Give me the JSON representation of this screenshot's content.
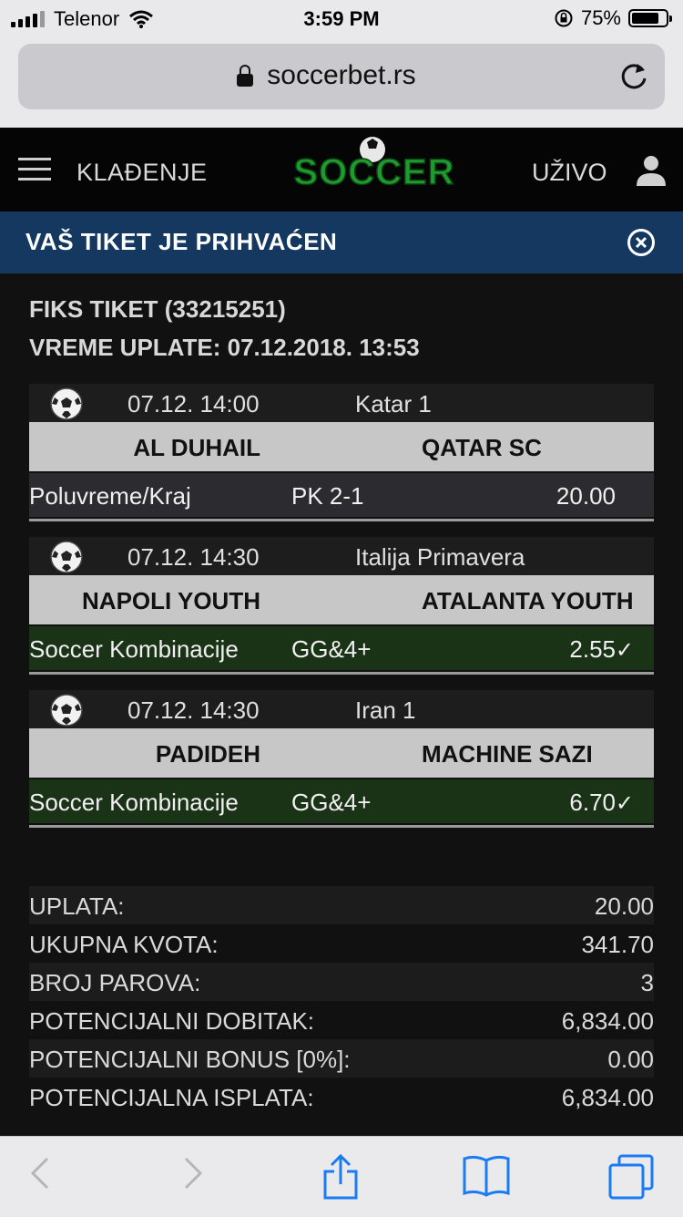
{
  "status_bar": {
    "carrier": "Telenor",
    "time": "3:59 PM",
    "battery": "75%",
    "battery_level": 0.75
  },
  "browser": {
    "host": "soccerbet.rs"
  },
  "header": {
    "menu_label": "KLAĐENJE",
    "logo_text": "SOCCER",
    "live_label": "UŽIVO"
  },
  "banner": {
    "message": "VAŠ TIKET JE PRIHVAĆEN"
  },
  "ticket": {
    "title": "FIKS TIKET (33215251)",
    "payment_time": "VREME UPLATE: 07.12.2018. 13:53"
  },
  "matches": [
    {
      "date": "07.12. 14:00",
      "league": "Katar 1",
      "home": "AL DUHAIL",
      "away": "QATAR SC",
      "market": "Poluvreme/Kraj",
      "pick": "PK 2-1",
      "odd": "20.00",
      "check": ""
    },
    {
      "date": "07.12. 14:30",
      "league": "Italija Primavera",
      "home": "NAPOLI YOUTH",
      "away": "ATALANTA YOUTH",
      "market": "Soccer Kombinacije",
      "pick": "GG&4+",
      "odd": "2.55",
      "check": "✓"
    },
    {
      "date": "07.12. 14:30",
      "league": "Iran 1",
      "home": "PADIDEH",
      "away": "MACHINE SAZI",
      "market": "Soccer Kombinacije",
      "pick": "GG&4+",
      "odd": "6.70",
      "check": "✓"
    }
  ],
  "summary": [
    {
      "label": "UPLATA:",
      "value": "20.00"
    },
    {
      "label": "UKUPNA KVOTA:",
      "value": "341.70"
    },
    {
      "label": "BROJ PAROVA:",
      "value": "3"
    },
    {
      "label": "POTENCIJALNI DOBITAK:",
      "value": "6,834.00"
    },
    {
      "label": "POTENCIJALNI BONUS [0%]:",
      "value": "0.00"
    },
    {
      "label": "POTENCIJALNA ISPLATA:",
      "value": "6,834.00"
    }
  ],
  "colors": {
    "banner": "#14385f",
    "won_row": "#1a3317",
    "logo_green": "#1f9a2e",
    "ios_blue": "#1a7cf5"
  },
  "icons": [
    "signal-icon",
    "wifi-icon",
    "orientation-lock-icon",
    "battery-icon",
    "lock-icon",
    "reload-icon",
    "hamburger-icon",
    "user-icon",
    "close-icon",
    "soccer-ball-icon",
    "back-icon",
    "forward-icon",
    "share-icon",
    "bookmarks-icon",
    "tabs-icon"
  ]
}
